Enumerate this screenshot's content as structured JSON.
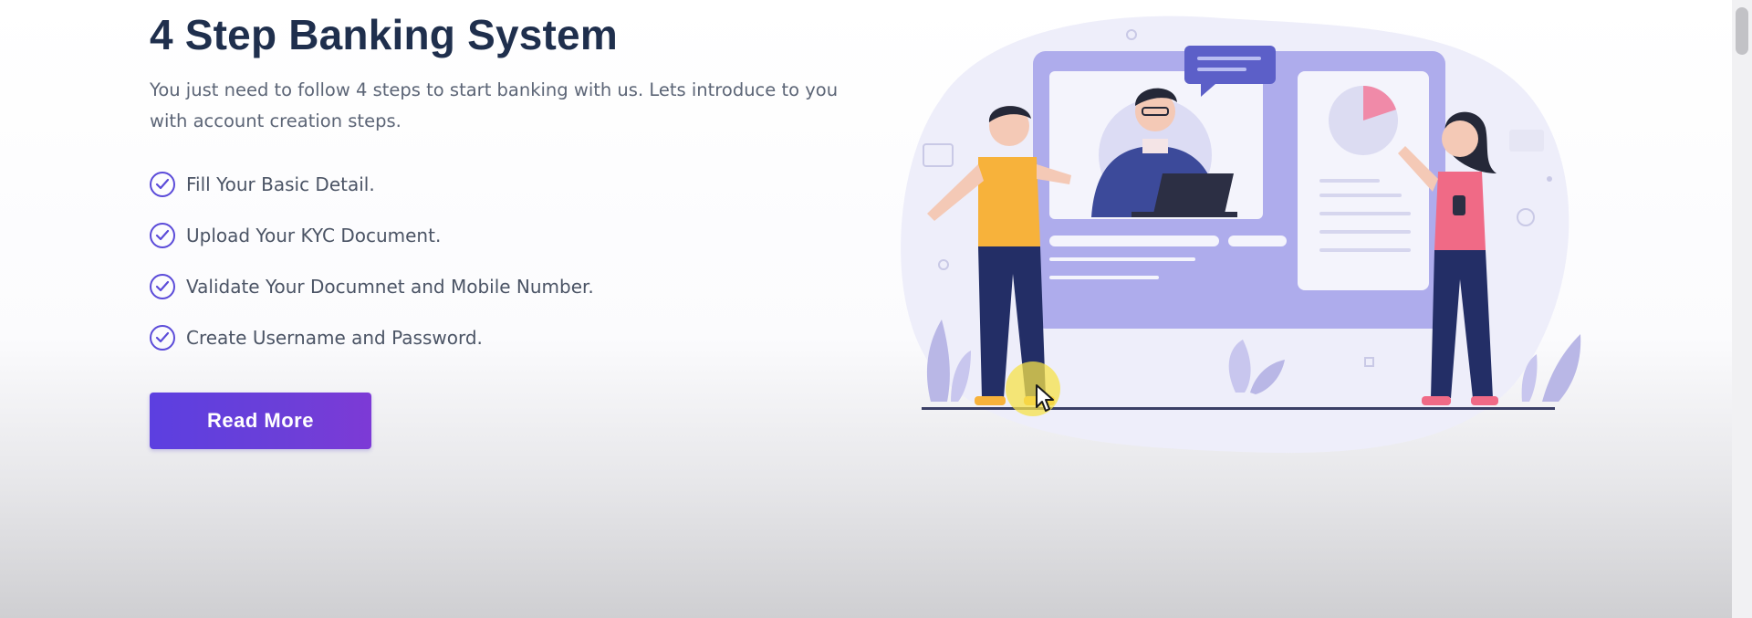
{
  "section": {
    "title": "4 Step Banking System",
    "description": "You just need to follow 4 steps to start banking with us. Lets introduce to you with account creation steps.",
    "steps": [
      {
        "label": "Fill Your Basic Detail.",
        "icon": "check-circle-icon"
      },
      {
        "label": "Upload Your KYC Document.",
        "icon": "check-circle-icon"
      },
      {
        "label": "Validate Your Documnet and Mobile Number.",
        "icon": "check-circle-icon"
      },
      {
        "label": "Create Username and Password.",
        "icon": "check-circle-icon"
      }
    ],
    "read_more_label": "Read More"
  },
  "illustration": {
    "subject": "video-call-banking-illustration"
  },
  "colors": {
    "title": "#1f2f4d",
    "body_text": "#5c6576",
    "accent": "#5b4bd9",
    "button_start": "#5c3fe0",
    "button_end": "#7d3ad6",
    "illustration_purple": "#a9a7e6",
    "illustration_navy": "#232e66",
    "illustration_yellow": "#f7b23b",
    "illustration_pink": "#f06a86"
  }
}
